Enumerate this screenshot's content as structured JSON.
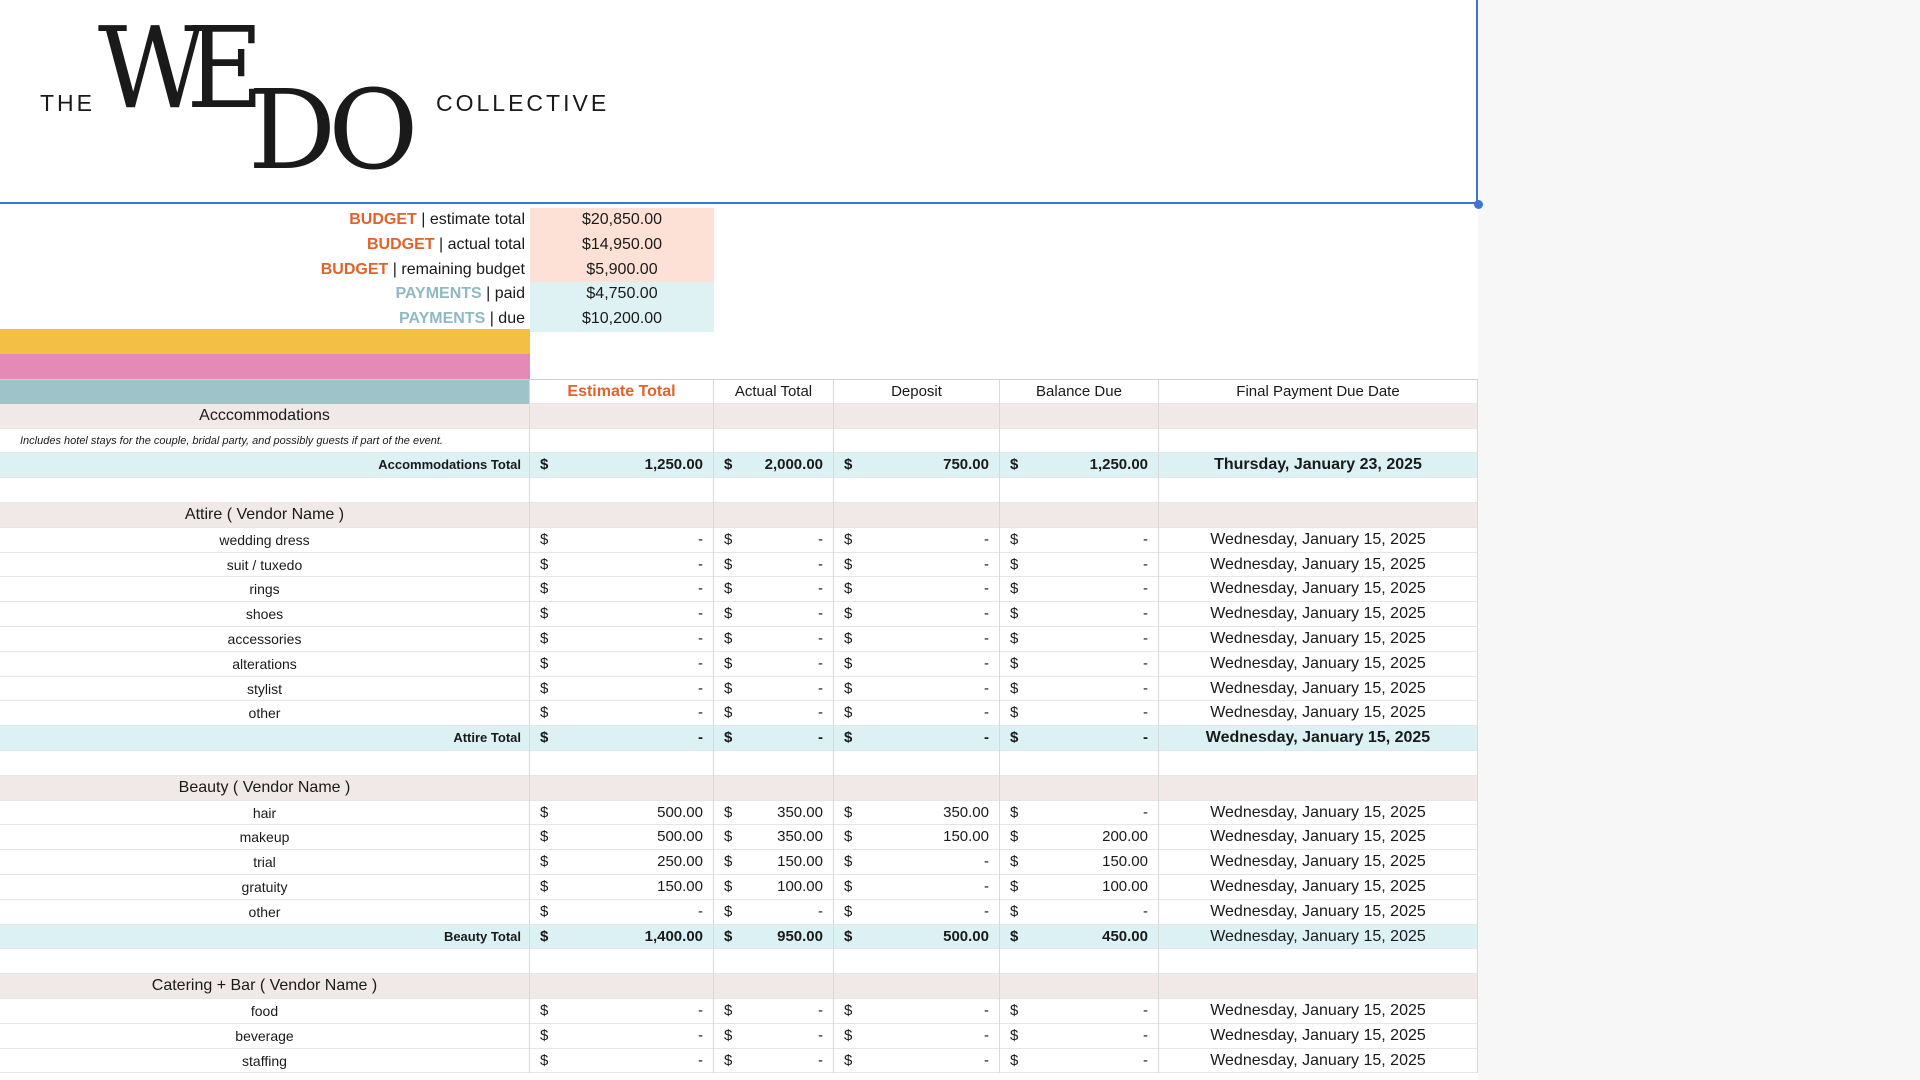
{
  "logo": {
    "the": "THE",
    "we": "WE",
    "do": "DO",
    "collective": "COLLECTIVE"
  },
  "summary": [
    {
      "keyword": "BUDGET",
      "suffix": " | estimate total",
      "value": "$20,850.00",
      "kind": "budget"
    },
    {
      "keyword": "BUDGET",
      "suffix": " | actual total",
      "value": "$14,950.00",
      "kind": "budget"
    },
    {
      "keyword": "BUDGET",
      "suffix": " | remaining budget",
      "value": "$5,900.00",
      "kind": "budget"
    },
    {
      "keyword": "PAYMENTS",
      "suffix": " | paid",
      "value": "$4,750.00",
      "kind": "payment"
    },
    {
      "keyword": "PAYMENTS",
      "suffix": " | due",
      "value": "$10,200.00",
      "kind": "payment"
    }
  ],
  "colors": {
    "accent_orange": "#e2622a",
    "yellow_band": "#f3bf44",
    "pink_band": "#e58ab6",
    "teal_header": "#9ec4c9"
  },
  "headers": {
    "estimate": "Estimate Total",
    "actual": "Actual Total",
    "deposit": "Deposit",
    "balance": "Balance Due",
    "date": "Final Payment Due Date"
  },
  "rows": [
    {
      "type": "section",
      "label": "Acccommodations"
    },
    {
      "type": "desc",
      "label": "Includes hotel stays for the couple, bridal party, and possibly guests if part of the event."
    },
    {
      "type": "total",
      "label": "Accommodations Total",
      "est": "1,250.00",
      "act": "2,000.00",
      "dep": "750.00",
      "bal": "1,250.00",
      "date": "Thursday, January 23, 2025"
    },
    {
      "type": "blank"
    },
    {
      "type": "section",
      "label": "Attire ( Vendor Name )"
    },
    {
      "type": "item",
      "label": "wedding dress",
      "est": "-",
      "act": "-",
      "dep": "-",
      "bal": "-",
      "date": "Wednesday, January 15, 2025"
    },
    {
      "type": "item",
      "label": "suit / tuxedo",
      "est": "-",
      "act": "-",
      "dep": "-",
      "bal": "-",
      "date": "Wednesday, January 15, 2025"
    },
    {
      "type": "item",
      "label": "rings",
      "est": "-",
      "act": "-",
      "dep": "-",
      "bal": "-",
      "date": "Wednesday, January 15, 2025"
    },
    {
      "type": "item",
      "label": "shoes",
      "est": "-",
      "act": "-",
      "dep": "-",
      "bal": "-",
      "date": "Wednesday, January 15, 2025"
    },
    {
      "type": "item",
      "label": "accessories",
      "est": "-",
      "act": "-",
      "dep": "-",
      "bal": "-",
      "date": "Wednesday, January 15, 2025"
    },
    {
      "type": "item",
      "label": "alterations",
      "est": "-",
      "act": "-",
      "dep": "-",
      "bal": "-",
      "date": "Wednesday, January 15, 2025"
    },
    {
      "type": "item",
      "label": "stylist",
      "est": "-",
      "act": "-",
      "dep": "-",
      "bal": "-",
      "date": "Wednesday, January 15, 2025"
    },
    {
      "type": "item",
      "label": "other",
      "est": "-",
      "act": "-",
      "dep": "-",
      "bal": "-",
      "date": "Wednesday, January 15, 2025"
    },
    {
      "type": "total",
      "label": "Attire Total",
      "est": "-",
      "act": "-",
      "dep": "-",
      "bal": "-",
      "date": "Wednesday, January 15, 2025"
    },
    {
      "type": "blank"
    },
    {
      "type": "section",
      "label": "Beauty ( Vendor Name )"
    },
    {
      "type": "item",
      "label": "hair",
      "est": "500.00",
      "act": "350.00",
      "dep": "350.00",
      "bal": "-",
      "date": "Wednesday, January 15, 2025"
    },
    {
      "type": "item",
      "label": "makeup",
      "est": "500.00",
      "act": "350.00",
      "dep": "150.00",
      "bal": "200.00",
      "date": "Wednesday, January 15, 2025"
    },
    {
      "type": "item",
      "label": "trial",
      "est": "250.00",
      "act": "150.00",
      "dep": "-",
      "bal": "150.00",
      "date": "Wednesday, January 15, 2025"
    },
    {
      "type": "item",
      "label": "gratuity",
      "est": "150.00",
      "act": "100.00",
      "dep": "-",
      "bal": "100.00",
      "date": "Wednesday, January 15, 2025"
    },
    {
      "type": "item",
      "label": "other",
      "est": "-",
      "act": "-",
      "dep": "-",
      "bal": "-",
      "date": "Wednesday, January 15, 2025"
    },
    {
      "type": "total",
      "label": "Beauty Total",
      "est": "1,400.00",
      "act": "950.00",
      "dep": "500.00",
      "bal": "450.00",
      "date": "Wednesday, January 15, 2025",
      "plain_date": true
    },
    {
      "type": "blank"
    },
    {
      "type": "section",
      "label": "Catering + Bar ( Vendor Name )"
    },
    {
      "type": "item",
      "label": "food",
      "est": "-",
      "act": "-",
      "dep": "-",
      "bal": "-",
      "date": "Wednesday, January 15, 2025"
    },
    {
      "type": "item",
      "label": "beverage",
      "est": "-",
      "act": "-",
      "dep": "-",
      "bal": "-",
      "date": "Wednesday, January 15, 2025"
    },
    {
      "type": "item",
      "label": "staffing",
      "est": "-",
      "act": "-",
      "dep": "-",
      "bal": "-",
      "date": "Wednesday, January 15, 2025"
    }
  ],
  "currency_symbol": "$"
}
